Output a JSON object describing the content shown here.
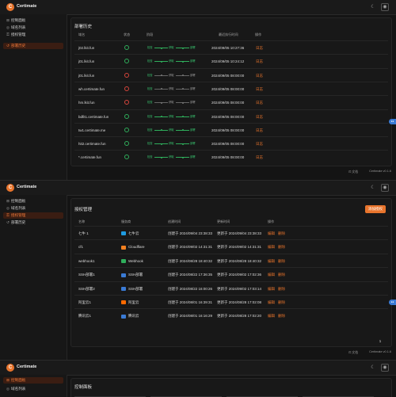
{
  "app": {
    "title": "Certimate",
    "logo_letter": "C"
  },
  "sidebar": {
    "items": [
      {
        "label": "控制面板",
        "icon": "dashboard-icon"
      },
      {
        "label": "域名列表",
        "icon": "globe-icon"
      },
      {
        "label": "授权管理",
        "icon": "key-icon"
      },
      {
        "label": "部署历史",
        "icon": "history-icon"
      }
    ]
  },
  "footer": {
    "docs": "文档",
    "version": "Certimate v0.1.6"
  },
  "history": {
    "title": "部署历史",
    "columns": [
      "域名",
      "状态",
      "阶段",
      "最近执行时间",
      "操作"
    ],
    "stage_labels": {
      "check": "检查",
      "apply": "获取",
      "deploy": "部署"
    },
    "rows": [
      {
        "domain": "j02.lkit.fun",
        "ok": true,
        "stage": 3,
        "time": "2024/09/05 10:27:36",
        "action": "日志"
      },
      {
        "domain": "j01.lkit.fun",
        "ok": true,
        "stage": 3,
        "time": "2024/09/05 10:24:12",
        "action": "日志"
      },
      {
        "domain": "j01.lkit.fun",
        "ok": false,
        "stage": 1,
        "time": "2024/09/05 08:00:00",
        "action": "日志"
      },
      {
        "domain": "wh.certimate.fun",
        "ok": false,
        "stage": 1,
        "time": "2024/09/05 08:00:00",
        "action": "日志"
      },
      {
        "domain": "hm.lkit.fun",
        "ok": false,
        "stage": 1,
        "time": "2024/09/05 08:00:00",
        "action": "日志"
      },
      {
        "domain": "bdfit1.certimate.fun",
        "ok": true,
        "stage": 3,
        "time": "2024/09/05 08:00:00",
        "action": "日志"
      },
      {
        "domain": "tw1.certimate.me",
        "ok": true,
        "stage": 3,
        "time": "2024/09/05 08:00:00",
        "action": "日志"
      },
      {
        "domain": "hit2.certimate.fun",
        "ok": true,
        "stage": 3,
        "time": "2024/09/05 08:00:00",
        "action": "日志"
      },
      {
        "domain": "*.certimate.fun",
        "ok": true,
        "stage": 3,
        "time": "2024/09/05 08:00:00",
        "action": "日志"
      }
    ]
  },
  "access": {
    "title": "授权管理",
    "add_button": "添加授权",
    "columns": [
      "名称",
      "服务商",
      "创建时间",
      "更新时间",
      "操作"
    ],
    "edit_label": "编辑",
    "delete_label": "删除",
    "rows": [
      {
        "name": "七牛 1",
        "provider": "七牛云",
        "color": "#1f9be0",
        "created": "创建于 2024/09/04 23:38:33",
        "updated": "更新于 2024/09/04 23:38:33"
      },
      {
        "name": "cf1",
        "provider": "Cloudflare",
        "color": "#f38020",
        "created": "创建于 2024/09/02 14:31:31",
        "updated": "更新于 2024/09/02 14:31:31"
      },
      {
        "name": "webhook1",
        "provider": "Webhook",
        "color": "#2fae5b",
        "created": "创建于 2024/08/28 18:40:32",
        "updated": "更新于 2024/08/28 18:40:32"
      },
      {
        "name": "SSH部署1",
        "provider": "SSH部署",
        "color": "#3a7bd5",
        "created": "创建于 2024/08/22 17:36:35",
        "updated": "更新于 2024/09/02 17:02:36"
      },
      {
        "name": "SSH部署2",
        "provider": "SSH部署",
        "color": "#3a7bd5",
        "created": "创建于 2024/08/22 16:00:26",
        "updated": "更新于 2024/09/02 17:03:14"
      },
      {
        "name": "阿里云1",
        "provider": "阿里云",
        "color": "#ff6a00",
        "created": "创建于 2024/08/01 16:39:31",
        "updated": "更新于 2024/08/28 17:02:08"
      },
      {
        "name": "腾讯云1",
        "provider": "腾讯云",
        "color": "#3a7bd5",
        "created": "创建于 2024/08/01 16:16:29",
        "updated": "更新于 2024/08/28 17:02:20"
      }
    ],
    "page": "1"
  },
  "dashboard": {
    "title": "控制面板"
  },
  "icons": {
    "theme": "moon-icon",
    "user": "user-icon",
    "float": "chat-bubble-icon"
  }
}
